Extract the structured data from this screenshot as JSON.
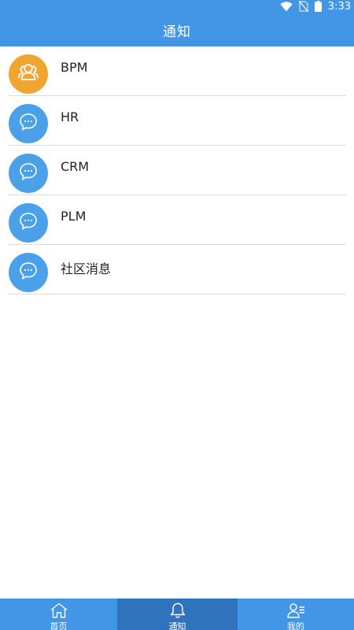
{
  "status_bar": {
    "time": "3:33",
    "icons": [
      "wifi-icon",
      "no-sim-icon",
      "battery-icon"
    ]
  },
  "header": {
    "title": "通知"
  },
  "colors": {
    "primary": "#4395e6",
    "tab_active": "#3073bd",
    "avatar_orange": "#f0a431",
    "avatar_blue": "#4aa1ea"
  },
  "notifications": [
    {
      "label": "BPM",
      "icon": "group-icon"
    },
    {
      "label": "HR",
      "icon": "chat-bubble-icon"
    },
    {
      "label": "CRM",
      "icon": "chat-bubble-icon"
    },
    {
      "label": "PLM",
      "icon": "chat-bubble-icon"
    },
    {
      "label": "社区消息",
      "icon": "chat-bubble-icon"
    }
  ],
  "tabbar": {
    "tabs": [
      {
        "label": "首页",
        "icon": "home-icon",
        "active": false
      },
      {
        "label": "通知",
        "icon": "bell-icon",
        "active": true
      },
      {
        "label": "我的",
        "icon": "user-profile-icon",
        "active": false
      }
    ]
  }
}
